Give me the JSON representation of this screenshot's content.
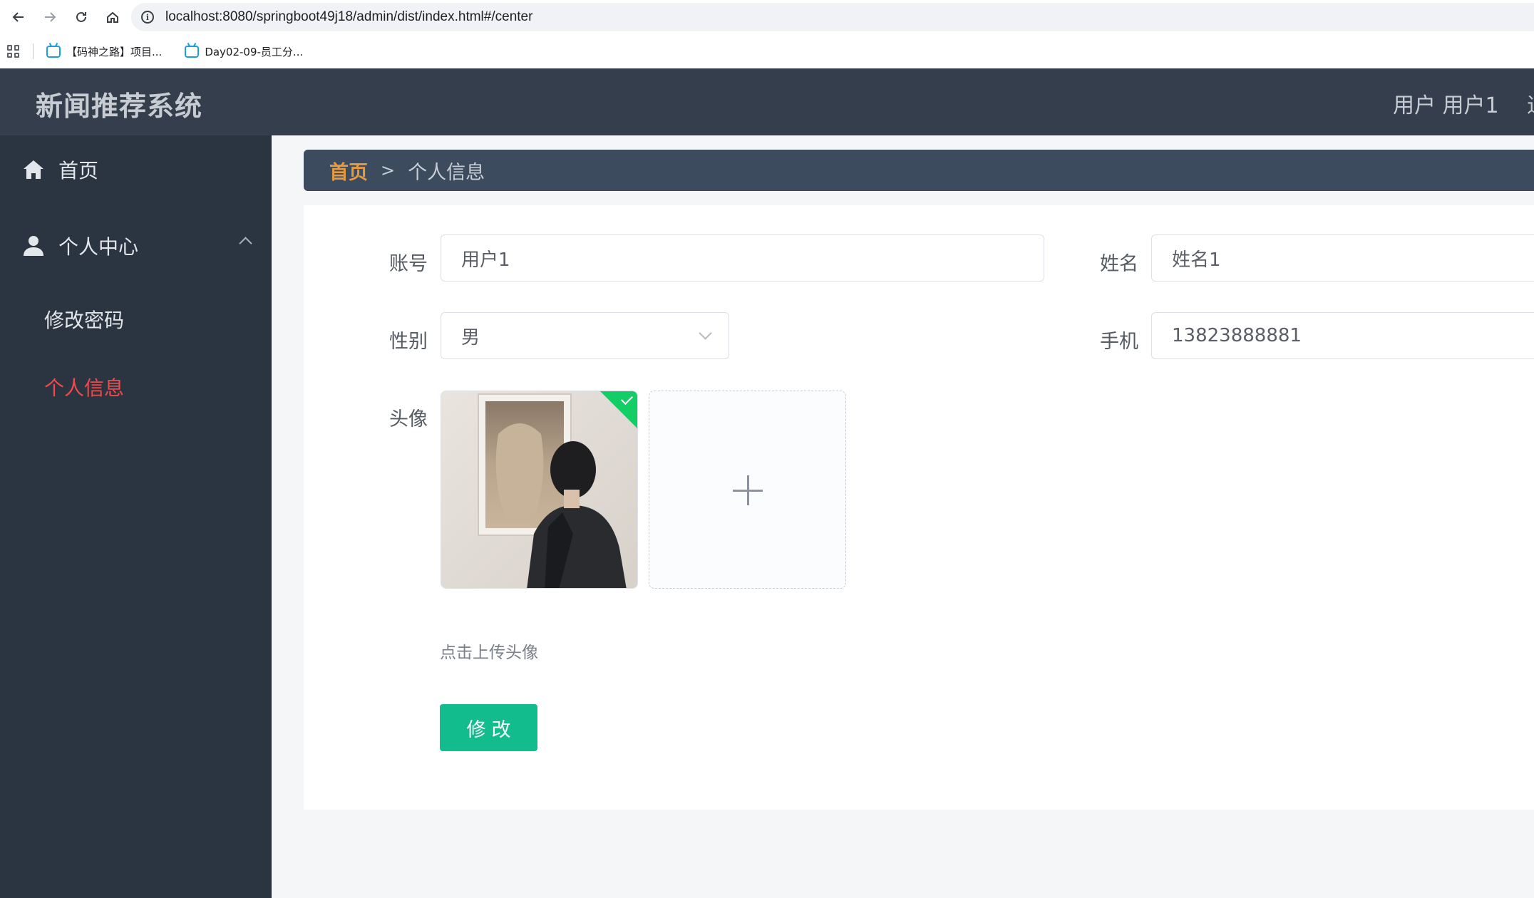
{
  "browser": {
    "url": "localhost:8080/springboot49j18/admin/dist/index.html#/center",
    "bookmarks": [
      {
        "label": "【码神之路】项目..."
      },
      {
        "label": "Day02-09-员工分..."
      }
    ]
  },
  "header": {
    "title": "新闻推荐系统",
    "user_text": "用户 用户1",
    "cut_text": "退"
  },
  "sidebar": {
    "items": [
      {
        "label": "首页",
        "icon": "home-icon"
      },
      {
        "label": "个人中心",
        "icon": "user-icon",
        "expanded": true,
        "children": [
          {
            "label": "修改密码"
          },
          {
            "label": "个人信息",
            "active": true
          }
        ]
      }
    ]
  },
  "breadcrumb": {
    "home": "首页",
    "separator": ">",
    "current": "个人信息"
  },
  "form": {
    "account_label": "账号",
    "account_value": "用户1",
    "name_label": "姓名",
    "name_value": "姓名1",
    "gender_label": "性别",
    "gender_value": "男",
    "phone_label": "手机",
    "phone_value": "13823888881",
    "avatar_label": "头像",
    "upload_hint": "点击上传头像",
    "submit_label": "修改"
  },
  "colors": {
    "header_bg": "#343e4c",
    "sidebar_bg": "#2b3441",
    "active_menu": "#f04a4a",
    "breadcrumb_home": "#e69a3f",
    "primary_button": "#13bc8d",
    "upload_success": "#13ce66"
  }
}
